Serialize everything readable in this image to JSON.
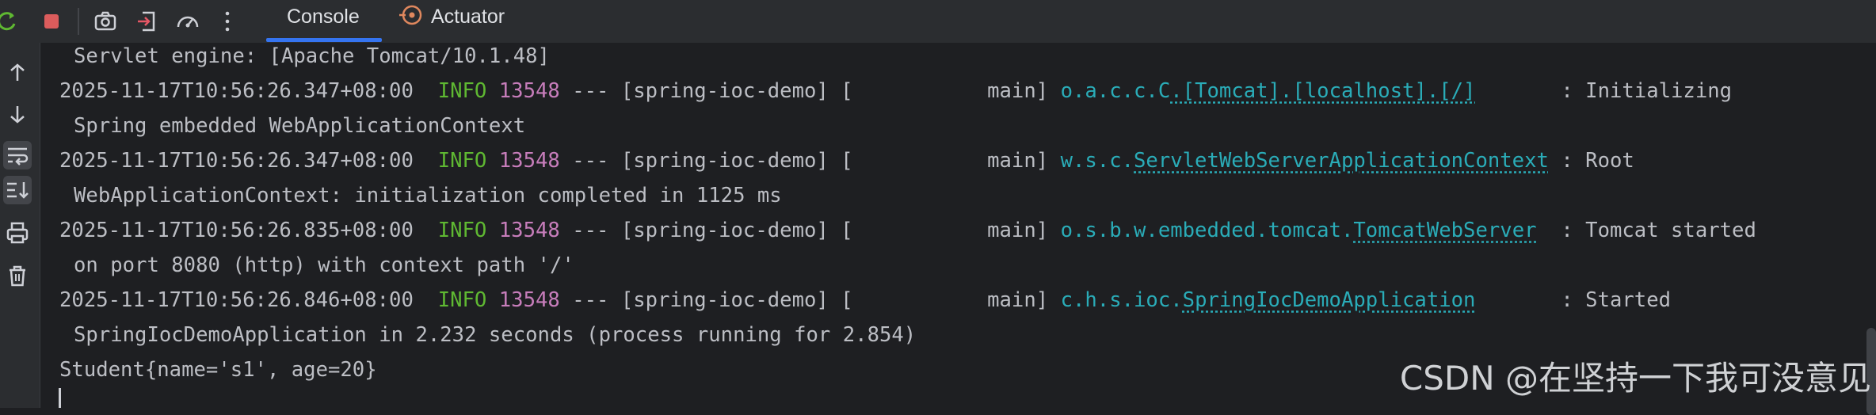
{
  "toolbar": {
    "icons": [
      "rerun-icon",
      "stop-icon",
      "screenshot-icon",
      "exit-icon",
      "dashboard-icon",
      "more-icon"
    ]
  },
  "tabs": [
    {
      "label": "Console",
      "active": true
    },
    {
      "label": "Actuator",
      "active": false
    }
  ],
  "sidebar": {
    "icons": [
      "scroll-up-icon",
      "scroll-down-icon",
      "soft-wrap-icon",
      "scroll-to-end-icon",
      "print-icon",
      "clear-icon"
    ]
  },
  "console": {
    "line0": "Servlet engine: [Apache Tomcat/10.1.48]",
    "log1": {
      "timestamp": "2025-11-17T10:56:26.347+08:00",
      "level": "INFO",
      "pid": "13548",
      "mid": " --- [spring-ioc-demo] [           main] ",
      "logger_pre": "o.a.c.c.C",
      "logger_link": ".[Tomcat].[localhost].[/]",
      "sep": "       : ",
      "message": "Initializing",
      "cont": "Spring embedded WebApplicationContext"
    },
    "log2": {
      "timestamp": "2025-11-17T10:56:26.347+08:00",
      "level": "INFO",
      "pid": "13548",
      "mid": " --- [spring-ioc-demo] [           main] ",
      "logger_pre": "w.s.c.",
      "logger_link": "ServletWebServerApplicationContext",
      "sep": " : ",
      "message": "Root",
      "cont": "WebApplicationContext: initialization completed in 1125 ms"
    },
    "log3": {
      "timestamp": "2025-11-17T10:56:26.835+08:00",
      "level": "INFO",
      "pid": "13548",
      "mid": " --- [spring-ioc-demo] [           main] ",
      "logger_pre": "o.s.b.w.embedded.tomcat.",
      "logger_link": "TomcatWebServer",
      "sep": "  : ",
      "message": "Tomcat started",
      "cont": "on port 8080 (http) with context path '/'"
    },
    "log4": {
      "timestamp": "2025-11-17T10:56:26.846+08:00",
      "level": "INFO",
      "pid": "13548",
      "mid": " --- [spring-ioc-demo] [           main] ",
      "logger_pre": "c.h.s.ioc.",
      "logger_link": "SpringIocDemoApplication",
      "sep": "       : ",
      "message": "Started",
      "cont": "SpringIocDemoApplication in 2.232 seconds (process running for 2.854)"
    },
    "output": "Student{name='s1', age=20}"
  },
  "watermark": "CSDN @在坚持一下我可没意见",
  "colors": {
    "background": "#1e1f22",
    "info": "#5fb832",
    "pid": "#c77dbb",
    "logger": "#2aacb8",
    "tab_accent": "#3574f0"
  }
}
